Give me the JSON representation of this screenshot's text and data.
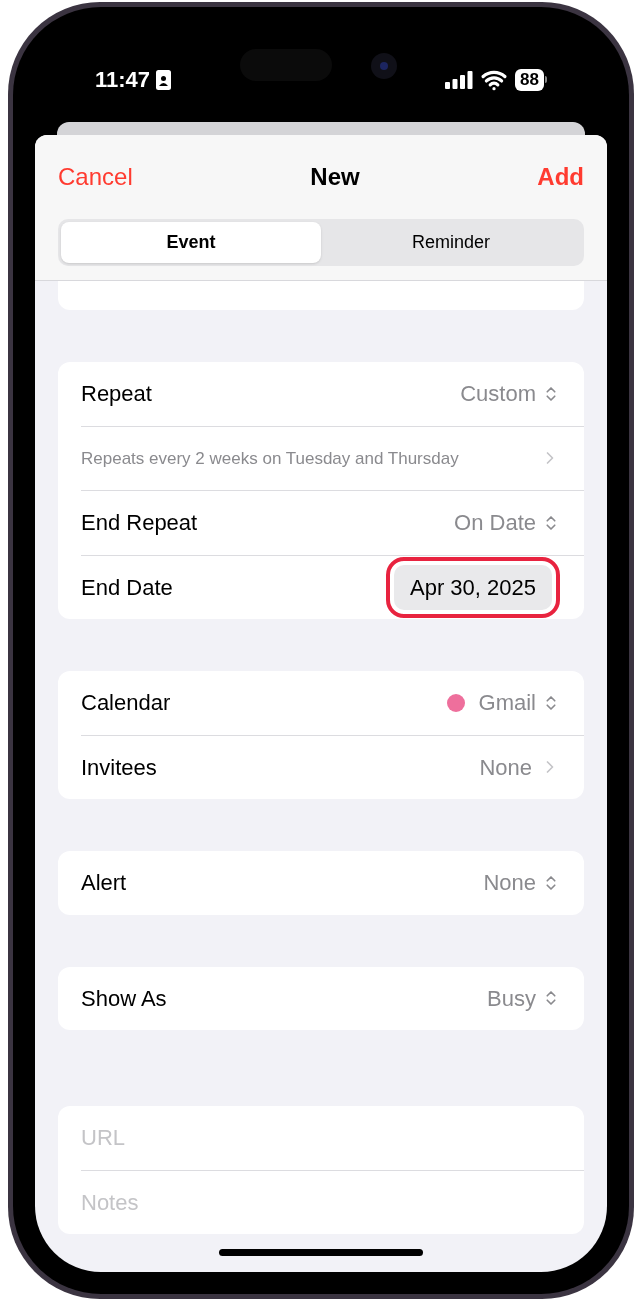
{
  "status_bar": {
    "time": "11:47",
    "battery": "88"
  },
  "header": {
    "cancel": "Cancel",
    "title": "New",
    "add": "Add"
  },
  "segments": [
    {
      "label": "Event",
      "selected": true
    },
    {
      "label": "Reminder",
      "selected": false
    }
  ],
  "groups": [
    {
      "rows": [
        {
          "kind": "select",
          "label": "Repeat",
          "value": "Custom"
        },
        {
          "kind": "summary",
          "label": "Repeats every 2 weeks on Tuesday and Thursday"
        },
        {
          "kind": "select",
          "label": "End Repeat",
          "value": "On Date"
        },
        {
          "kind": "date",
          "label": "End Date",
          "value": "Apr 30, 2025",
          "highlighted": true
        }
      ]
    },
    {
      "rows": [
        {
          "kind": "select",
          "label": "Calendar",
          "value": "Gmail",
          "color": "#ee6f9c"
        },
        {
          "kind": "link",
          "label": "Invitees",
          "value": "None"
        }
      ]
    },
    {
      "rows": [
        {
          "kind": "select",
          "label": "Alert",
          "value": "None"
        }
      ]
    },
    {
      "rows": [
        {
          "kind": "select",
          "label": "Show As",
          "value": "Busy"
        }
      ]
    },
    {
      "rows": [
        {
          "kind": "placeholder",
          "placeholder": "URL"
        },
        {
          "kind": "placeholder",
          "placeholder": "Notes"
        }
      ]
    }
  ]
}
